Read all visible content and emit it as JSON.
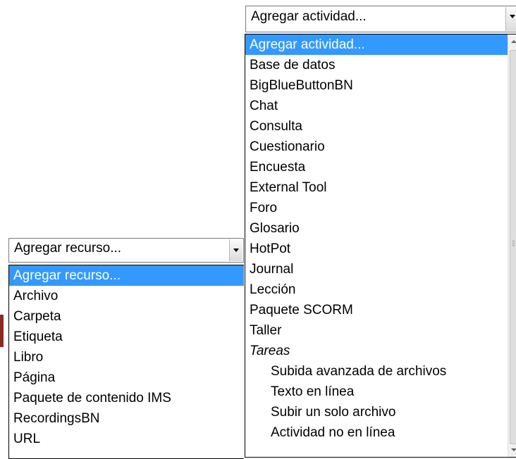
{
  "activity_select": {
    "value": "Agregar actividad...",
    "options": [
      "Agregar actividad...",
      "Base de datos",
      "BigBlueButtonBN",
      "Chat",
      "Consulta",
      "Cuestionario",
      "Encuesta",
      "External Tool",
      "Foro",
      "Glosario",
      "HotPot",
      "Journal",
      "Lección",
      "Paquete SCORM",
      "Taller"
    ],
    "group_label": "Tareas",
    "group_options": [
      "Subida avanzada de archivos",
      "Texto en línea",
      "Subir un solo archivo",
      "Actividad no en línea"
    ]
  },
  "resource_select": {
    "value": "Agregar recurso...",
    "options": [
      "Agregar recurso...",
      "Archivo",
      "Carpeta",
      "Etiqueta",
      "Libro",
      "Página",
      "Paquete de contenido IMS",
      "RecordingsBN",
      "URL"
    ]
  },
  "colors": {
    "highlight": "#3399ff",
    "highlight_text": "#ffffff",
    "border": "#7a7a7a"
  },
  "icons": {
    "dropdown_arrow": "chevron-down-icon",
    "scroll_up": "scroll-up-arrow-icon",
    "scroll_down": "scroll-down-arrow-icon"
  }
}
